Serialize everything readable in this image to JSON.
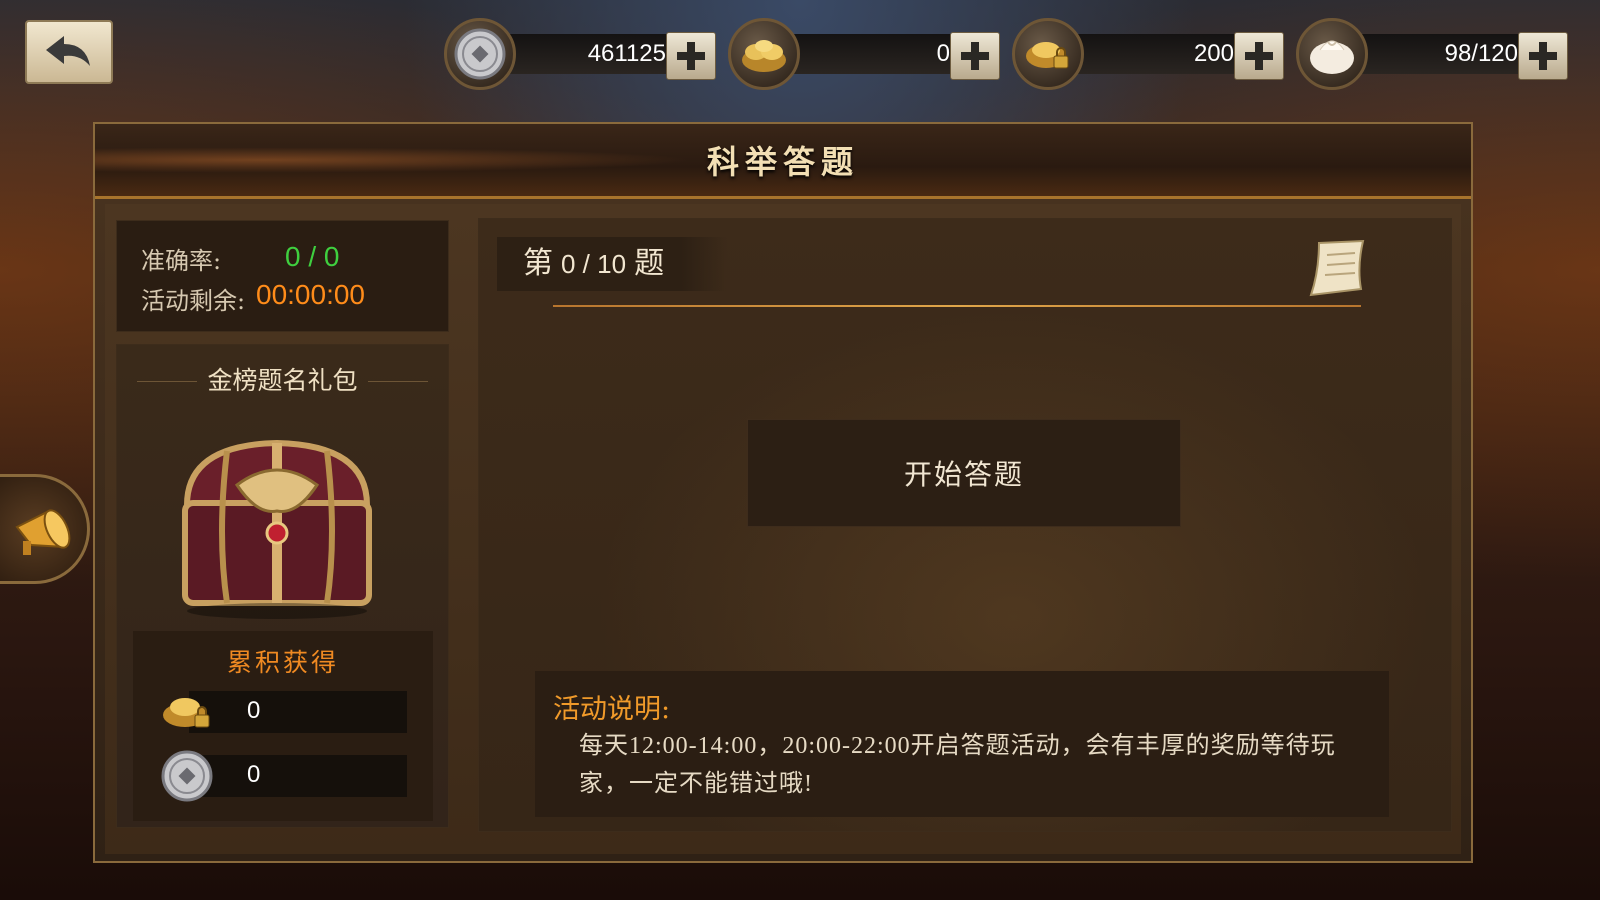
{
  "topbar": {
    "resources": [
      {
        "name": "copper-coin",
        "value": "461125"
      },
      {
        "name": "gold-ingot",
        "value": "0"
      },
      {
        "name": "bound-gold-ingot",
        "value": "200"
      },
      {
        "name": "bun-stamina",
        "value": "98/120"
      }
    ]
  },
  "panel": {
    "title": "科举答题"
  },
  "stats": {
    "accuracy_label": "准确率:",
    "accuracy_value": "0 / 0",
    "remaining_label": "活动剩余:",
    "remaining_value": "00:00:00"
  },
  "gift": {
    "title": "金榜题名礼包",
    "accum_title": "累积获得",
    "rows": [
      {
        "icon": "bound-gold-ingot-icon",
        "value": "0"
      },
      {
        "icon": "copper-coin-icon",
        "value": "0"
      }
    ]
  },
  "quiz": {
    "prefix": "第",
    "progress": "0 / 10",
    "suffix": "题",
    "start_label": "开始答题",
    "desc_title": "活动说明:",
    "desc_text": "每天12:00-14:00，20:00-22:00开启答题活动，会有丰厚的奖励等待玩家，一定不能错过哦!"
  },
  "colors": {
    "accuracy": "#3fcf3f",
    "timer": "#ff8c1a",
    "accent_orange": "#f08a22"
  }
}
